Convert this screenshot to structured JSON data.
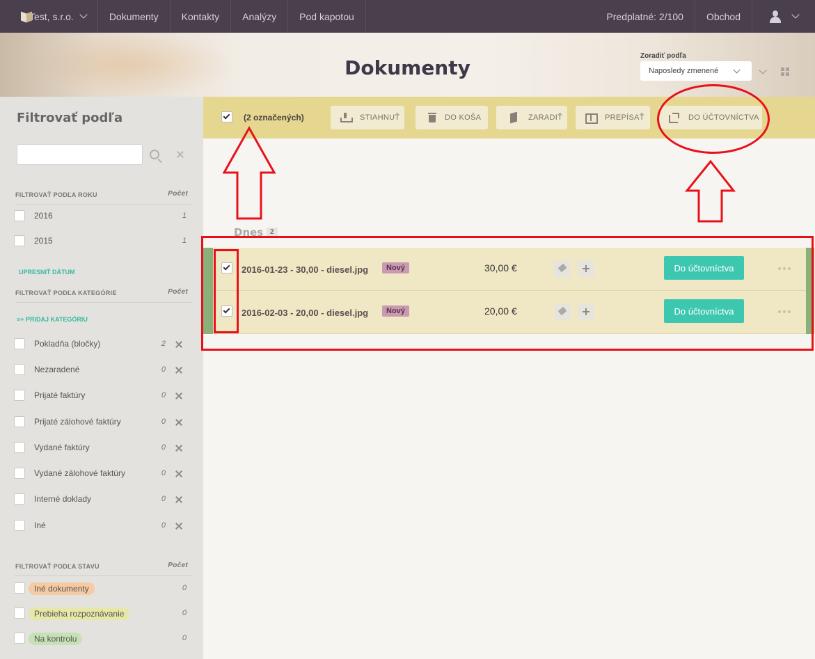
{
  "nav": {
    "company": "Test, s.r.o.",
    "links": [
      "Dokumenty",
      "Kontakty",
      "Analýzy",
      "Pod kapotou"
    ],
    "subscription": "Predplatné: 2/100",
    "shop": "Obchod"
  },
  "header": {
    "title": "Dokumenty",
    "sort_label": "Zoradiť podľa",
    "sort_value": "Naposledy zmenené"
  },
  "sidebar": {
    "title": "Filtrovať podľa",
    "count_header": "Počet",
    "year_section": "FILTROVAŤ PODĽA ROKU",
    "years": [
      {
        "label": "2016",
        "count": "1"
      },
      {
        "label": "2015",
        "count": "1"
      }
    ],
    "refine_date": "UPRESNIŤ DÁTUM",
    "category_section": "FILTROVAŤ PODĽA KATEGÓRIE",
    "add_category": "≡+ PRIDAJ KATEGÓRIU",
    "categories": [
      {
        "label": "Pokladňa (bločky)",
        "count": "2"
      },
      {
        "label": "Nezaradené",
        "count": "0"
      },
      {
        "label": "Prijaté faktúry",
        "count": "0"
      },
      {
        "label": "Prijaté zálohové faktúry",
        "count": "0"
      },
      {
        "label": "Vydané faktúry",
        "count": "0"
      },
      {
        "label": "Vydané zálohové faktúry",
        "count": "0"
      },
      {
        "label": "Interné doklady",
        "count": "0"
      },
      {
        "label": "Iné",
        "count": "0"
      }
    ],
    "status_section": "FILTROVAŤ PODĽA STAVU",
    "statuses": [
      {
        "label": "Iné dokumenty",
        "count": "0",
        "color": "#f6caa2"
      },
      {
        "label": "Prebieha rozpoznávanie",
        "count": "0",
        "color": "#e7e7a7"
      },
      {
        "label": "Na kontrolu",
        "count": "0",
        "color": "#c6e1b6"
      }
    ]
  },
  "actionbar": {
    "selected": "(2 označených)",
    "download": "STIAHNUŤ",
    "trash": "DO KOŠA",
    "classify": "ZARADIŤ",
    "transcribe": "PREPÍSAŤ",
    "to_accounting": "DO ÚČTOVNÍCTVA"
  },
  "group": {
    "label": "Dnes",
    "count": "2"
  },
  "documents": [
    {
      "name": "2016-01-23 - 30,00 - diesel.jpg",
      "badge": "Nový",
      "amount": "30,00 €",
      "action": "Do účtovníctva"
    },
    {
      "name": "2016-02-03 - 20,00 - diesel.jpg",
      "badge": "Nový",
      "amount": "20,00 €",
      "action": "Do účtovníctva"
    }
  ],
  "colors": {
    "nav": "#4a3f4d",
    "actionbar": "#e6d790",
    "row": "#f0e8c4",
    "teal": "#3ec7b0",
    "badge": "#c99bb3",
    "annotation": "#e8111a"
  }
}
